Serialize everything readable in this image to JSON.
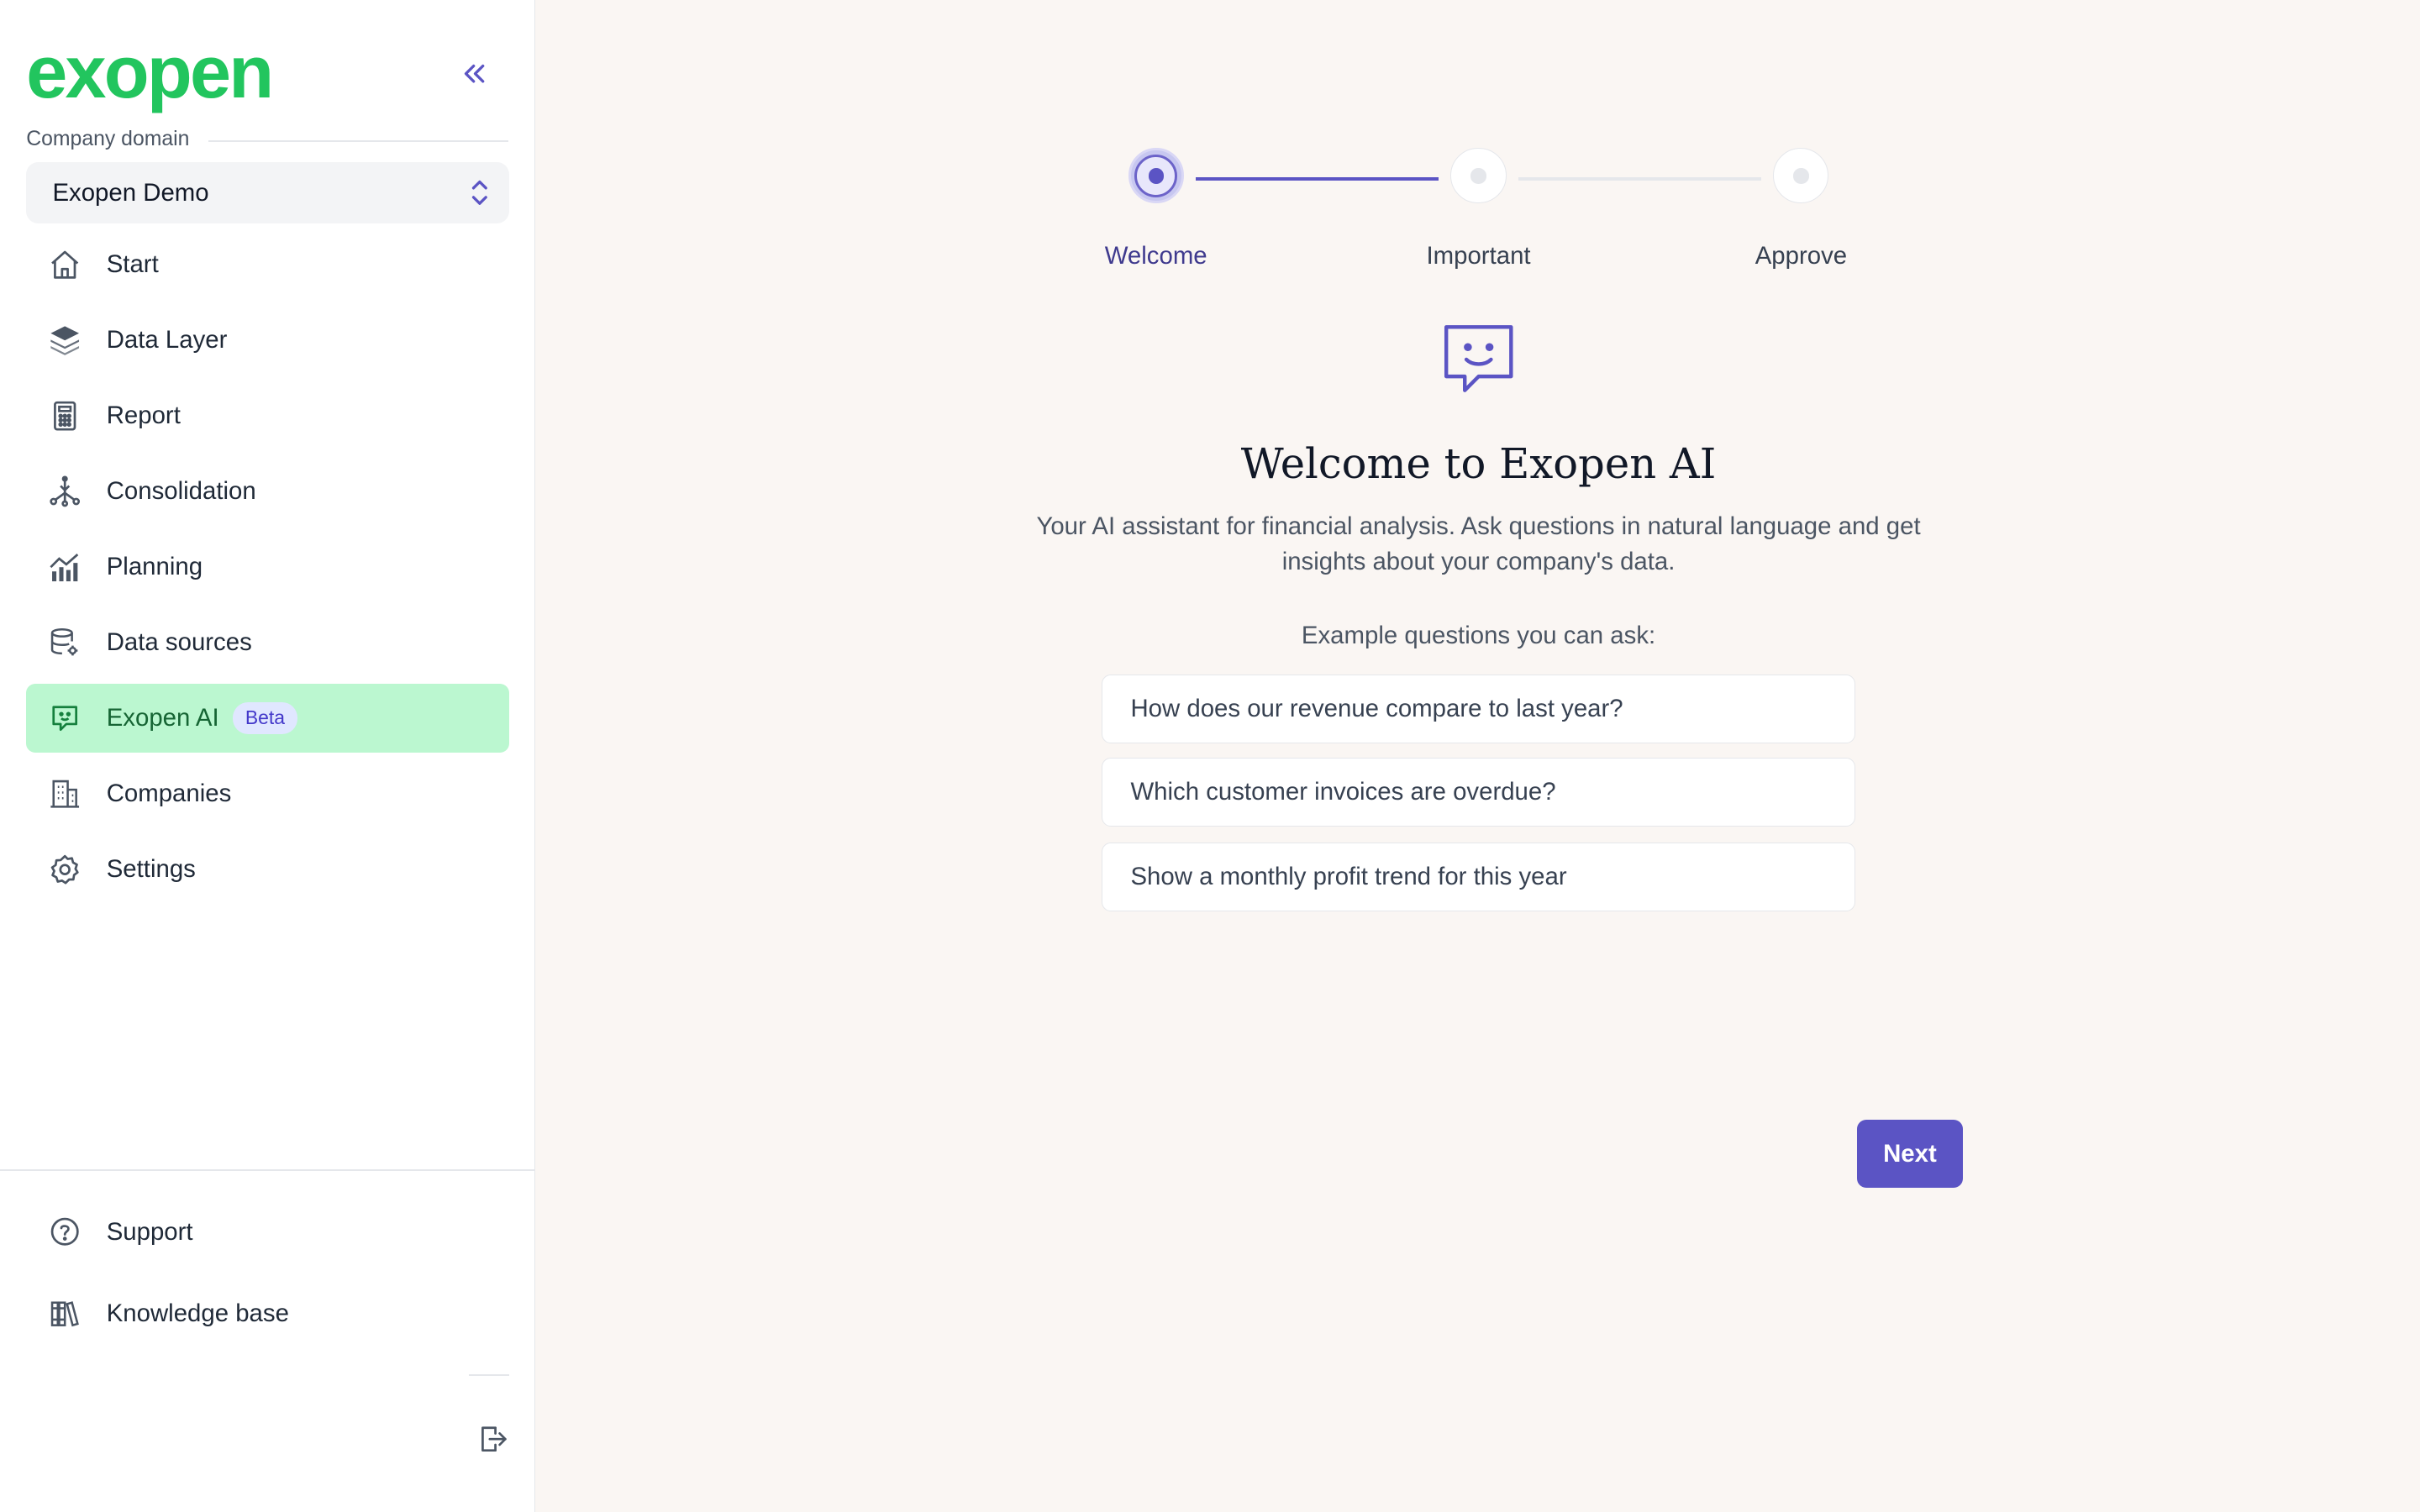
{
  "sidebar": {
    "logo": "exopen",
    "domain_label": "Company domain",
    "domain_value": "Exopen Demo",
    "items": [
      {
        "label": "Start",
        "icon": "home-icon"
      },
      {
        "label": "Data Layer",
        "icon": "layers-icon"
      },
      {
        "label": "Report",
        "icon": "calculator-icon"
      },
      {
        "label": "Consolidation",
        "icon": "hierarchy-icon"
      },
      {
        "label": "Planning",
        "icon": "chart-icon"
      },
      {
        "label": "Data sources",
        "icon": "database-icon"
      },
      {
        "label": "Exopen AI",
        "icon": "chat-icon",
        "badge": "Beta",
        "active": true
      },
      {
        "label": "Companies",
        "icon": "building-icon"
      },
      {
        "label": "Settings",
        "icon": "gear-icon"
      }
    ],
    "bottom": [
      {
        "label": "Support",
        "icon": "help-icon"
      },
      {
        "label": "Knowledge base",
        "icon": "books-icon"
      }
    ]
  },
  "stepper": {
    "steps": [
      "Welcome",
      "Important",
      "Approve"
    ],
    "current_step": 1
  },
  "main": {
    "title": "Welcome to Exopen AI",
    "subtitle": "Your AI assistant for financial analysis. Ask questions in natural language and get insights about your company's data.",
    "examples_label": "Example questions you can ask:",
    "examples": [
      "How does our revenue compare to last year?",
      "Which customer invoices are overdue?",
      "Show a monthly profit trend for this year"
    ],
    "next_label": "Next"
  },
  "colors": {
    "brand_green": "#22c55e",
    "accent_purple": "#5b54c4",
    "active_nav_bg": "#bbf7d0",
    "page_bg": "#faf6f3"
  }
}
